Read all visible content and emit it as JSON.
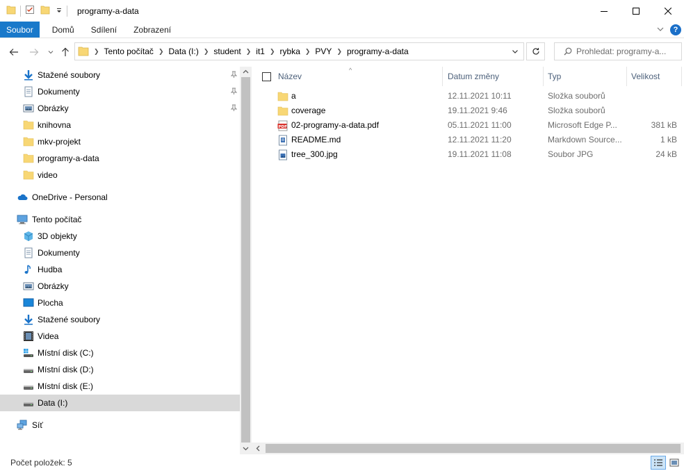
{
  "window": {
    "title": "programy-a-data"
  },
  "ribbon": {
    "tabs": [
      {
        "label": "Soubor",
        "active": true
      },
      {
        "label": "Domů"
      },
      {
        "label": "Sdílení"
      },
      {
        "label": "Zobrazení"
      }
    ]
  },
  "address": {
    "crumbs": [
      "Tento počítač",
      "Data (I:)",
      "student",
      "it1",
      "rybka",
      "PVY",
      "programy-a-data"
    ]
  },
  "search": {
    "placeholder": "Prohledat: programy-a..."
  },
  "sidebar": {
    "quick": [
      {
        "label": "Stažené soubory",
        "icon": "download-icon",
        "pinned": true
      },
      {
        "label": "Dokumenty",
        "icon": "documents-icon",
        "pinned": true
      },
      {
        "label": "Obrázky",
        "icon": "pictures-icon",
        "pinned": true
      },
      {
        "label": "knihovna",
        "icon": "folder-icon"
      },
      {
        "label": "mkv-projekt",
        "icon": "folder-icon"
      },
      {
        "label": "programy-a-data",
        "icon": "folder-icon"
      },
      {
        "label": "video",
        "icon": "folder-icon"
      }
    ],
    "onedrive": {
      "label": "OneDrive - Personal",
      "icon": "cloud-icon"
    },
    "pc": {
      "label": "Tento počítač",
      "icon": "computer-icon"
    },
    "pc_items": [
      {
        "label": "3D objekty",
        "icon": "3d-objects-icon"
      },
      {
        "label": "Dokumenty",
        "icon": "documents-icon"
      },
      {
        "label": "Hudba",
        "icon": "music-icon"
      },
      {
        "label": "Obrázky",
        "icon": "pictures-icon"
      },
      {
        "label": "Plocha",
        "icon": "desktop-icon"
      },
      {
        "label": "Stažené soubory",
        "icon": "download-icon"
      },
      {
        "label": "Videa",
        "icon": "videos-icon"
      },
      {
        "label": "Místní disk (C:)",
        "icon": "system-drive-icon"
      },
      {
        "label": "Místní disk (D:)",
        "icon": "drive-icon"
      },
      {
        "label": "Místní disk (E:)",
        "icon": "drive-icon"
      },
      {
        "label": "Data (I:)",
        "icon": "drive-icon",
        "selected": true
      }
    ],
    "network": {
      "label": "Síť",
      "icon": "network-icon"
    }
  },
  "columns": {
    "name": "Název",
    "date": "Datum změny",
    "type": "Typ",
    "size": "Velikost"
  },
  "files": [
    {
      "name": "a",
      "date": "12.11.2021 10:11",
      "type": "Složka souborů",
      "size": "",
      "icon": "folder-icon"
    },
    {
      "name": "coverage",
      "date": "19.11.2021 9:46",
      "type": "Složka souborů",
      "size": "",
      "icon": "folder-icon"
    },
    {
      "name": "02-programy-a-data.pdf",
      "date": "05.11.2021 11:00",
      "type": "Microsoft Edge P...",
      "size": "381 kB",
      "icon": "pdf-icon"
    },
    {
      "name": "README.md",
      "date": "12.11.2021 11:20",
      "type": "Markdown Source...",
      "size": "1 kB",
      "icon": "text-file-icon"
    },
    {
      "name": "tree_300.jpg",
      "date": "19.11.2021 11:08",
      "type": "Soubor JPG",
      "size": "24 kB",
      "icon": "image-file-icon"
    }
  ],
  "status": {
    "count": "Počet položek: 5"
  },
  "colors": {
    "accent": "#1979ca",
    "folder": "#f8d775",
    "selection": "#d9d9d9"
  }
}
